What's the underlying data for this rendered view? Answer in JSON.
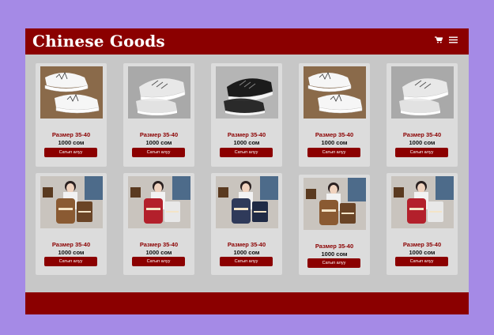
{
  "header": {
    "brand": "Chinese Goods",
    "icons": [
      "cart-icon",
      "menu-icon"
    ]
  },
  "colors": {
    "accent": "#8b0000",
    "page_bg": "#a58ae6",
    "content_bg": "#c7c7c7",
    "card_bg": "#dcdcdc"
  },
  "products": [
    {
      "kind": "shoe-white",
      "size": "Размер 35-40",
      "price": "1000 сом",
      "button": "Сатып алуу"
    },
    {
      "kind": "shoe-gray",
      "size": "Размер 35-40",
      "price": "1000 сом",
      "button": "Сатып алуу"
    },
    {
      "kind": "shoe-black",
      "size": "Размер 35-40",
      "price": "1000 сом",
      "button": "Сатып алуу"
    },
    {
      "kind": "shoe-white",
      "size": "Размер 35-40",
      "price": "1000 сом",
      "button": "Сатып алуу"
    },
    {
      "kind": "shoe-gray",
      "size": "Размер 35-40",
      "price": "1000 сом",
      "button": "Сатып алуу"
    },
    {
      "kind": "bag-brown",
      "size": "Размер 35-40",
      "price": "1000 сом",
      "button": "Сатып алуу"
    },
    {
      "kind": "bag-red",
      "size": "Размер 35-40",
      "price": "1000 сом",
      "button": "Сатып алуу"
    },
    {
      "kind": "bag-navy",
      "size": "Размер 35-40",
      "price": "1000 сом",
      "button": "Сатып алуу"
    },
    {
      "kind": "bag-brown",
      "size": "Размер 35-40",
      "price": "1000 сом",
      "button": "Сатып алуу"
    },
    {
      "kind": "bag-red",
      "size": "Размер 35-40",
      "price": "1000 сом",
      "button": "Сатып алуу"
    }
  ]
}
